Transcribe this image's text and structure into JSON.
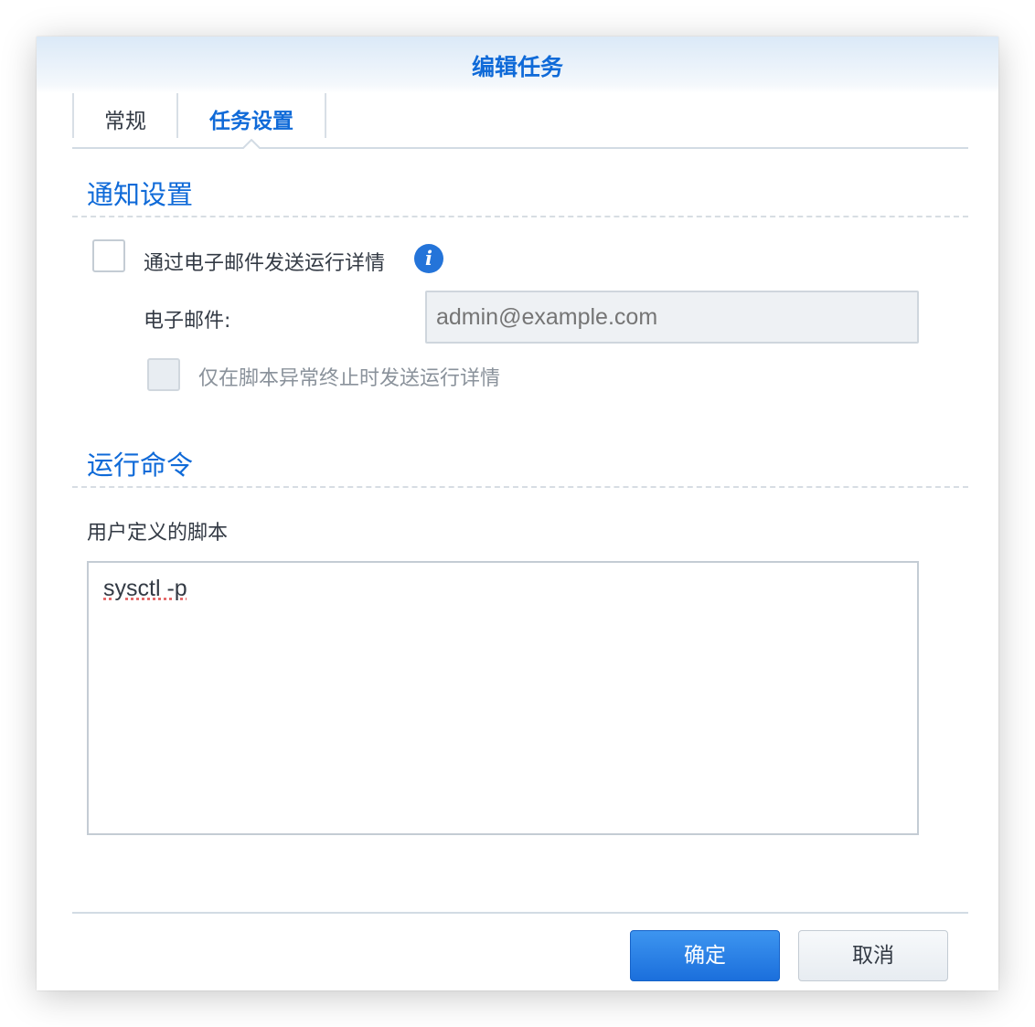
{
  "dialog": {
    "title": "编辑任务",
    "tabs": [
      {
        "label": "常规",
        "active": false
      },
      {
        "label": "任务设置",
        "active": true
      }
    ]
  },
  "notification": {
    "section_title": "通知设置",
    "send_email_label": "通过电子邮件发送运行详情",
    "send_email_checked": false,
    "email_label": "电子邮件:",
    "email_placeholder": "admin@example.com",
    "only_on_error_label": "仅在脚本异常终止时发送运行详情",
    "only_on_error_checked": false,
    "only_on_error_disabled": true
  },
  "command": {
    "section_title": "运行命令",
    "script_label": "用户定义的脚本",
    "script_value": "sysctl -p"
  },
  "footer": {
    "ok_label": "确定",
    "cancel_label": "取消"
  },
  "colors": {
    "accent": "#0f6ad8",
    "primary_button": "#1b6fdc",
    "info_icon": "#2474d9"
  }
}
